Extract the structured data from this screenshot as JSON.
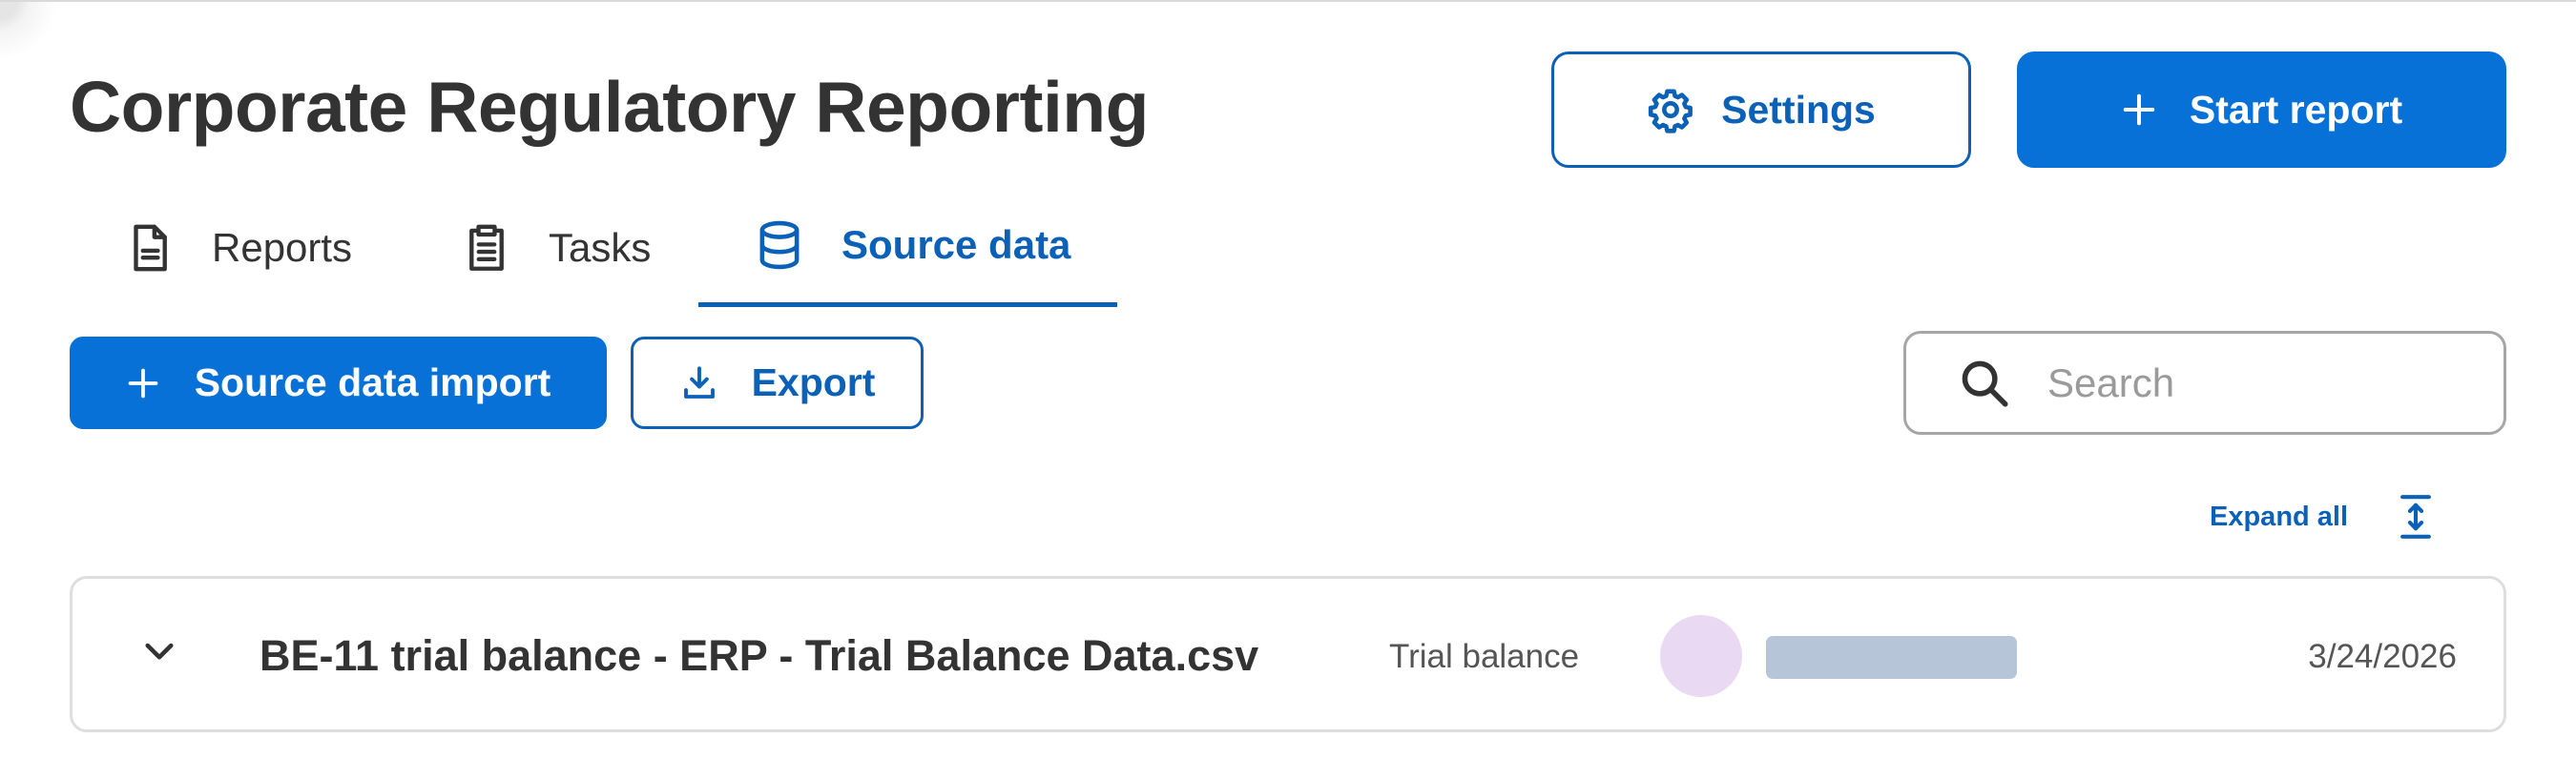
{
  "header": {
    "title": "Corporate Regulatory Reporting",
    "settings_label": "Settings",
    "start_report_label": "Start report"
  },
  "tabs": [
    {
      "label": "Reports",
      "icon": "document-icon",
      "active": false
    },
    {
      "label": "Tasks",
      "icon": "clipboard-icon",
      "active": false
    },
    {
      "label": "Source data",
      "icon": "database-icon",
      "active": true
    }
  ],
  "toolbar": {
    "import_label": "Source data import",
    "export_label": "Export",
    "search_placeholder": "Search",
    "search_value": "",
    "expand_all_label": "Expand all"
  },
  "rows": [
    {
      "name": "BE-11 trial balance - ERP - Trial Balance Data.csv",
      "type": "Trial balance",
      "date": "3/24/2026"
    }
  ],
  "colors": {
    "accent": "#0871d8",
    "accent_text": "#0b61b8",
    "border": "#dedede",
    "avatar": "#ead9f2",
    "redacted_user": "#b6c6d8"
  }
}
